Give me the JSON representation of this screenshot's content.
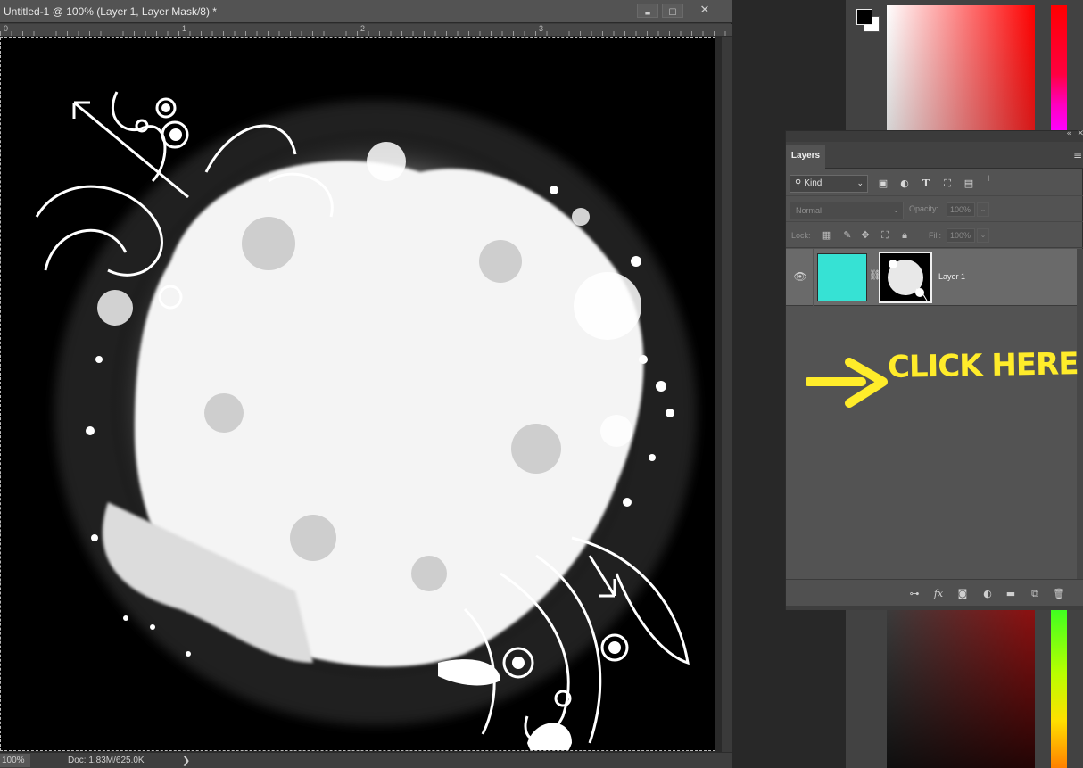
{
  "document": {
    "title": "Untitled-1 @ 100% (Layer 1, Layer Mask/8) *",
    "window_buttons": {
      "minimize": "▬",
      "maximize": "☐",
      "close": "✕"
    },
    "ruler_numbers": [
      "0",
      "1",
      "2",
      "3"
    ],
    "status": {
      "zoom": "100%",
      "doc_size": "Doc: 1.83M/625.0K",
      "arrow": "❯"
    }
  },
  "color_picker": {
    "foreground": "#000000",
    "background": "#ffffff",
    "hue_color": "#ff0000"
  },
  "layers_panel": {
    "tab_label": "Layers",
    "panel_menu": "≡",
    "collapse": "«",
    "close": "✕",
    "filter": {
      "label": "Kind",
      "icons": [
        "image-filter-icon",
        "adjustment-filter-icon",
        "type-filter-icon",
        "shape-filter-icon",
        "smart-object-filter-icon",
        "filter-toggle-icon"
      ]
    },
    "blend_mode": "Normal",
    "opacity_label": "Opacity:",
    "opacity_value": "100%",
    "lock_label": "Lock:",
    "fill_label": "Fill:",
    "fill_value": "100%",
    "layers": [
      {
        "name": "Layer 1",
        "visible": true,
        "thumb_color": "#36e2d4",
        "has_mask": true
      }
    ],
    "bottom_icons": [
      "link-layers-icon",
      "fx-icon",
      "add-mask-icon",
      "adjustment-layer-icon",
      "new-group-icon",
      "new-layer-icon",
      "delete-icon"
    ],
    "fx_label": "fx"
  },
  "annotation": {
    "text": "CLICK HERE",
    "color": "#ffec2a"
  }
}
